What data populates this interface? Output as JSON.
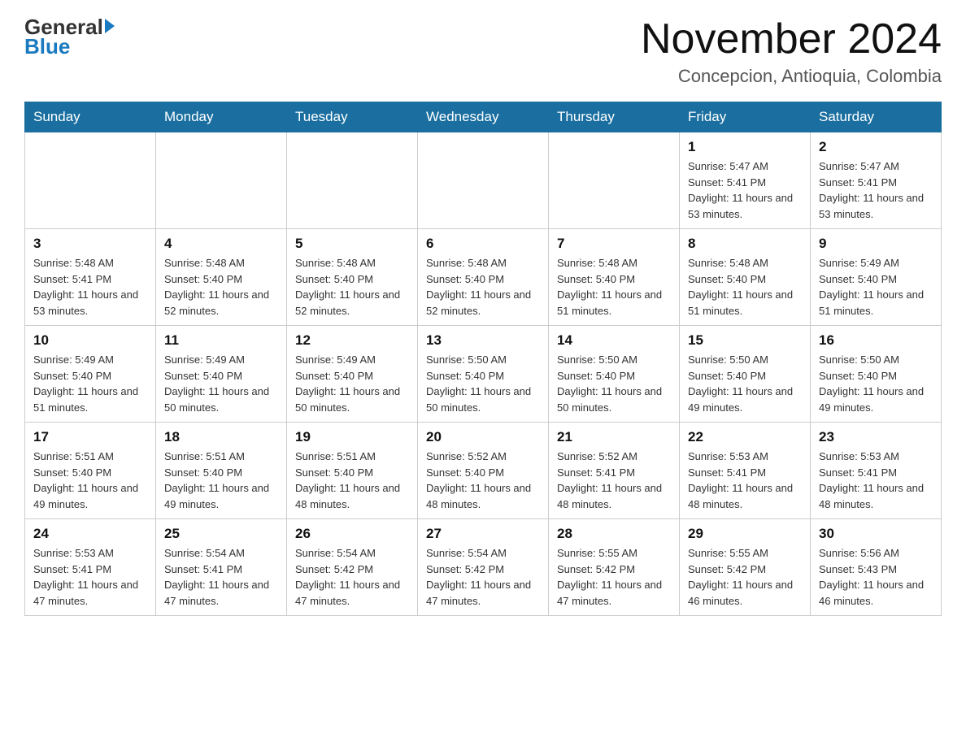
{
  "header": {
    "logo_general": "General",
    "logo_blue": "Blue",
    "month_title": "November 2024",
    "location": "Concepcion, Antioquia, Colombia"
  },
  "weekdays": [
    "Sunday",
    "Monday",
    "Tuesday",
    "Wednesday",
    "Thursday",
    "Friday",
    "Saturday"
  ],
  "weeks": [
    [
      {
        "day": "",
        "sunrise": "",
        "sunset": "",
        "daylight": ""
      },
      {
        "day": "",
        "sunrise": "",
        "sunset": "",
        "daylight": ""
      },
      {
        "day": "",
        "sunrise": "",
        "sunset": "",
        "daylight": ""
      },
      {
        "day": "",
        "sunrise": "",
        "sunset": "",
        "daylight": ""
      },
      {
        "day": "",
        "sunrise": "",
        "sunset": "",
        "daylight": ""
      },
      {
        "day": "1",
        "sunrise": "Sunrise: 5:47 AM",
        "sunset": "Sunset: 5:41 PM",
        "daylight": "Daylight: 11 hours and 53 minutes."
      },
      {
        "day": "2",
        "sunrise": "Sunrise: 5:47 AM",
        "sunset": "Sunset: 5:41 PM",
        "daylight": "Daylight: 11 hours and 53 minutes."
      }
    ],
    [
      {
        "day": "3",
        "sunrise": "Sunrise: 5:48 AM",
        "sunset": "Sunset: 5:41 PM",
        "daylight": "Daylight: 11 hours and 53 minutes."
      },
      {
        "day": "4",
        "sunrise": "Sunrise: 5:48 AM",
        "sunset": "Sunset: 5:40 PM",
        "daylight": "Daylight: 11 hours and 52 minutes."
      },
      {
        "day": "5",
        "sunrise": "Sunrise: 5:48 AM",
        "sunset": "Sunset: 5:40 PM",
        "daylight": "Daylight: 11 hours and 52 minutes."
      },
      {
        "day": "6",
        "sunrise": "Sunrise: 5:48 AM",
        "sunset": "Sunset: 5:40 PM",
        "daylight": "Daylight: 11 hours and 52 minutes."
      },
      {
        "day": "7",
        "sunrise": "Sunrise: 5:48 AM",
        "sunset": "Sunset: 5:40 PM",
        "daylight": "Daylight: 11 hours and 51 minutes."
      },
      {
        "day": "8",
        "sunrise": "Sunrise: 5:48 AM",
        "sunset": "Sunset: 5:40 PM",
        "daylight": "Daylight: 11 hours and 51 minutes."
      },
      {
        "day": "9",
        "sunrise": "Sunrise: 5:49 AM",
        "sunset": "Sunset: 5:40 PM",
        "daylight": "Daylight: 11 hours and 51 minutes."
      }
    ],
    [
      {
        "day": "10",
        "sunrise": "Sunrise: 5:49 AM",
        "sunset": "Sunset: 5:40 PM",
        "daylight": "Daylight: 11 hours and 51 minutes."
      },
      {
        "day": "11",
        "sunrise": "Sunrise: 5:49 AM",
        "sunset": "Sunset: 5:40 PM",
        "daylight": "Daylight: 11 hours and 50 minutes."
      },
      {
        "day": "12",
        "sunrise": "Sunrise: 5:49 AM",
        "sunset": "Sunset: 5:40 PM",
        "daylight": "Daylight: 11 hours and 50 minutes."
      },
      {
        "day": "13",
        "sunrise": "Sunrise: 5:50 AM",
        "sunset": "Sunset: 5:40 PM",
        "daylight": "Daylight: 11 hours and 50 minutes."
      },
      {
        "day": "14",
        "sunrise": "Sunrise: 5:50 AM",
        "sunset": "Sunset: 5:40 PM",
        "daylight": "Daylight: 11 hours and 50 minutes."
      },
      {
        "day": "15",
        "sunrise": "Sunrise: 5:50 AM",
        "sunset": "Sunset: 5:40 PM",
        "daylight": "Daylight: 11 hours and 49 minutes."
      },
      {
        "day": "16",
        "sunrise": "Sunrise: 5:50 AM",
        "sunset": "Sunset: 5:40 PM",
        "daylight": "Daylight: 11 hours and 49 minutes."
      }
    ],
    [
      {
        "day": "17",
        "sunrise": "Sunrise: 5:51 AM",
        "sunset": "Sunset: 5:40 PM",
        "daylight": "Daylight: 11 hours and 49 minutes."
      },
      {
        "day": "18",
        "sunrise": "Sunrise: 5:51 AM",
        "sunset": "Sunset: 5:40 PM",
        "daylight": "Daylight: 11 hours and 49 minutes."
      },
      {
        "day": "19",
        "sunrise": "Sunrise: 5:51 AM",
        "sunset": "Sunset: 5:40 PM",
        "daylight": "Daylight: 11 hours and 48 minutes."
      },
      {
        "day": "20",
        "sunrise": "Sunrise: 5:52 AM",
        "sunset": "Sunset: 5:40 PM",
        "daylight": "Daylight: 11 hours and 48 minutes."
      },
      {
        "day": "21",
        "sunrise": "Sunrise: 5:52 AM",
        "sunset": "Sunset: 5:41 PM",
        "daylight": "Daylight: 11 hours and 48 minutes."
      },
      {
        "day": "22",
        "sunrise": "Sunrise: 5:53 AM",
        "sunset": "Sunset: 5:41 PM",
        "daylight": "Daylight: 11 hours and 48 minutes."
      },
      {
        "day": "23",
        "sunrise": "Sunrise: 5:53 AM",
        "sunset": "Sunset: 5:41 PM",
        "daylight": "Daylight: 11 hours and 48 minutes."
      }
    ],
    [
      {
        "day": "24",
        "sunrise": "Sunrise: 5:53 AM",
        "sunset": "Sunset: 5:41 PM",
        "daylight": "Daylight: 11 hours and 47 minutes."
      },
      {
        "day": "25",
        "sunrise": "Sunrise: 5:54 AM",
        "sunset": "Sunset: 5:41 PM",
        "daylight": "Daylight: 11 hours and 47 minutes."
      },
      {
        "day": "26",
        "sunrise": "Sunrise: 5:54 AM",
        "sunset": "Sunset: 5:42 PM",
        "daylight": "Daylight: 11 hours and 47 minutes."
      },
      {
        "day": "27",
        "sunrise": "Sunrise: 5:54 AM",
        "sunset": "Sunset: 5:42 PM",
        "daylight": "Daylight: 11 hours and 47 minutes."
      },
      {
        "day": "28",
        "sunrise": "Sunrise: 5:55 AM",
        "sunset": "Sunset: 5:42 PM",
        "daylight": "Daylight: 11 hours and 47 minutes."
      },
      {
        "day": "29",
        "sunrise": "Sunrise: 5:55 AM",
        "sunset": "Sunset: 5:42 PM",
        "daylight": "Daylight: 11 hours and 46 minutes."
      },
      {
        "day": "30",
        "sunrise": "Sunrise: 5:56 AM",
        "sunset": "Sunset: 5:43 PM",
        "daylight": "Daylight: 11 hours and 46 minutes."
      }
    ]
  ]
}
